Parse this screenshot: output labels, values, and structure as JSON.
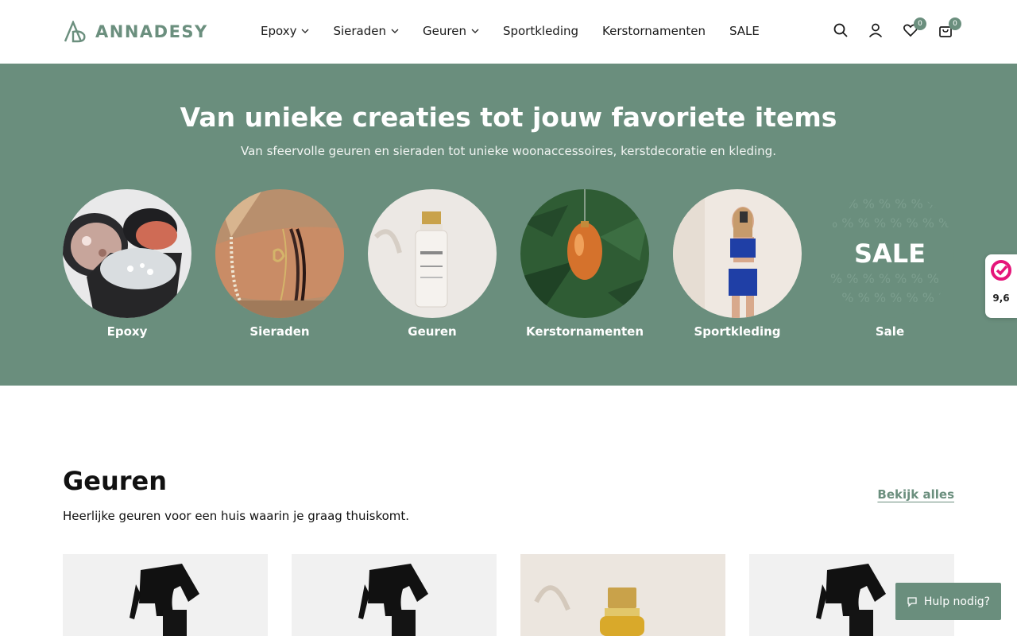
{
  "brand": {
    "name": "ANNADESY",
    "accent": "#6a8e7d"
  },
  "nav": [
    {
      "label": "Epoxy",
      "dropdown": true
    },
    {
      "label": "Sieraden",
      "dropdown": true
    },
    {
      "label": "Geuren",
      "dropdown": true
    },
    {
      "label": "Sportkleding",
      "dropdown": false
    },
    {
      "label": "Kerstornamenten",
      "dropdown": false
    },
    {
      "label": "SALE",
      "dropdown": false
    }
  ],
  "header_icons": {
    "wishlist_count": "0",
    "cart_count": "0"
  },
  "hero": {
    "title": "Van unieke creaties tot jouw favoriete items",
    "subtitle": "Van sfeervolle geuren en sieraden tot unieke woonaccessoires, kerstdecoratie en kleding.",
    "categories": [
      {
        "label": "Epoxy",
        "icon": "epoxy-image"
      },
      {
        "label": "Sieraden",
        "icon": "jewelry-image"
      },
      {
        "label": "Geuren",
        "icon": "fragrance-image"
      },
      {
        "label": "Kerstornamenten",
        "icon": "ornament-image"
      },
      {
        "label": "Sportkleding",
        "icon": "sportswear-image"
      },
      {
        "label": "Sale",
        "icon": "sale-image",
        "overlay": "SALE"
      }
    ]
  },
  "review_widget": {
    "score": "9,6"
  },
  "section": {
    "title": "Geuren",
    "description": "Heerlijke geuren voor een huis waarin je graag thuiskomt.",
    "see_all": "Bekijk alles"
  },
  "help_button": {
    "label": "Hulp nodig?"
  }
}
